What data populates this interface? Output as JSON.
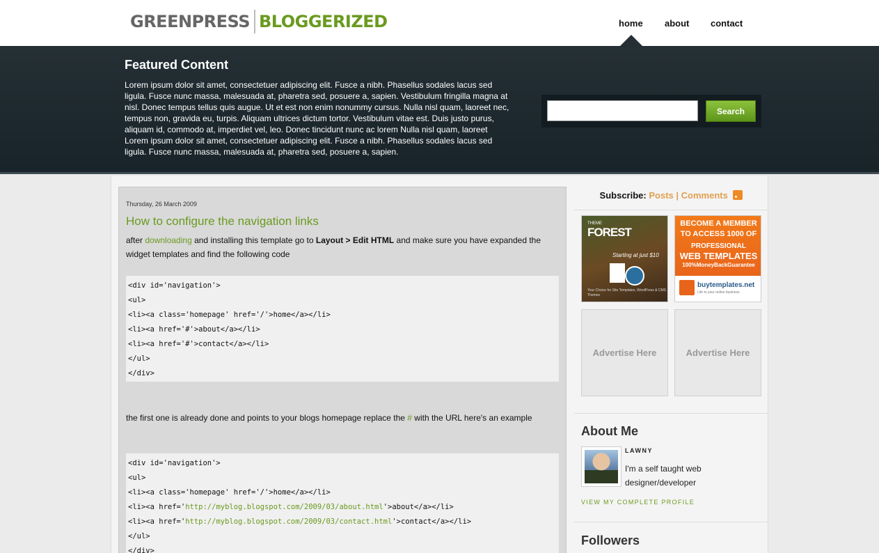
{
  "logo": {
    "left": "GREENPRESS",
    "right": "BLOGGERIZED"
  },
  "nav": [
    "home",
    "about",
    "contact"
  ],
  "featured": {
    "title": "Featured Content",
    "text": "Lorem ipsum dolor sit amet, consectetuer adipiscing elit. Fusce a nibh. Phasellus sodales lacus sed ligula. Fusce nunc massa, malesuada at, pharetra sed, posuere a, sapien. Vestibulum fringilla magna at nisl. Donec tempus tellus quis augue. Ut et est non enim nonummy cursus. Nulla nisl quam, laoreet nec, tempus non, gravida eu, turpis. Aliquam ultrices dictum tortor. Vestibulum vitae est. Duis justo purus, aliquam id, commodo at, imperdiet vel, leo. Donec tincidunt nunc ac lorem Nulla nisl quam, laoreet Lorem ipsum dolor sit amet, consectetuer adipiscing elit. Fusce a nibh. Phasellus sodales lacus sed ligula. Fusce nunc massa, malesuada at, pharetra sed, posuere a, sapien."
  },
  "search": {
    "value": "",
    "button": "Search"
  },
  "post": {
    "date": "Thursday, 26 March 2009",
    "title": "How to configure the navigation links",
    "p1": {
      "a": "after ",
      "link": "downloading",
      "b": " and installing this template go to ",
      "strong": "Layout > Edit HTML",
      "c": " and make sure you have expanded the widget templates and find the following code"
    },
    "code1": [
      "<div id='navigation'>",
      "<ul>",
      "<li><a class='homepage' href='/'>home</a></li>",
      "<li><a href='#'>about</a></li>",
      "<li><a href='#'>contact</a></li>",
      "</ul>",
      "</div>"
    ],
    "p2": {
      "a": "the first one is already done and points to your blogs homepage replace the ",
      "hash": "#",
      "b": " with the URL here's an example"
    },
    "code2": {
      "l1": "<div id='navigation'>",
      "l2": "<ul>",
      "l3": "<li><a class='homepage' href='/'>home</a></li>",
      "l4a": "<li><a href='",
      "l4url": "http://myblog.blogspot.com/2009/03/about.html",
      "l4b": "'>about</a></li>",
      "l5a": "<li><a href='",
      "l5url": "http://myblog.blogspot.com/2009/03/contact.html",
      "l5b": "'>contact</a></li>",
      "l6": "</ul>",
      "l7": "</div>"
    }
  },
  "sidebar": {
    "subscribe": {
      "label": "Subscribe:",
      "posts": "Posts",
      "sep": " | ",
      "comments": "Comments"
    },
    "ads": {
      "themeforest": {
        "small": "THEME",
        "name": "FOREST",
        "tag": "Starting at just $10",
        "foot": "Your Choice for Site Templates, WordPress & CMS Themes"
      },
      "buytemplates": {
        "l1": "BECOME A MEMBER",
        "l2": "TO ACCESS 1000 OF",
        "l3": "PROFESSIONAL",
        "l4": "WEB TEMPLATES",
        "l5": "100%MoneyBackGuarantee",
        "brand": "buytemplates.net",
        "slogan": "Life to your online business"
      },
      "empty1": "Advertise Here",
      "empty2": "Advertise Here"
    },
    "about": {
      "title": "About Me",
      "name": "LAWNY",
      "bio": "I'm a self taught web designer/developer",
      "profile_link": "VIEW MY COMPLETE PROFILE"
    },
    "followers": {
      "title": "Followers"
    }
  },
  "colors": {
    "accent": "#6a9a1f",
    "header_bg": "#253035",
    "link_orange": "#e0a050"
  }
}
